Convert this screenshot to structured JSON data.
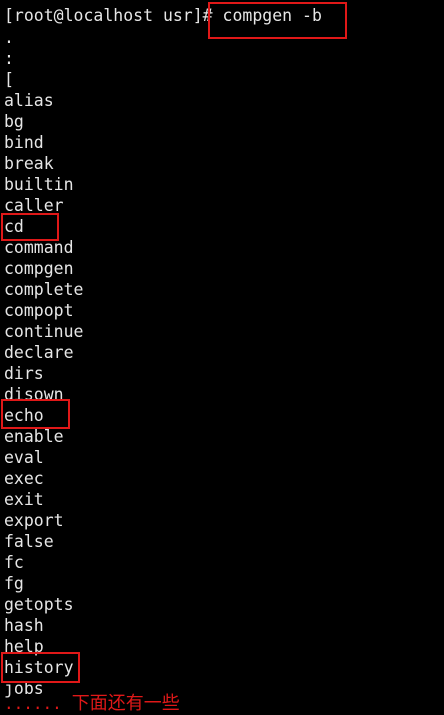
{
  "terminal": {
    "prompt": "[root@localhost usr]# ",
    "command": "compgen -b",
    "builtins": [
      ".",
      ":",
      "[",
      "alias",
      "bg",
      "bind",
      "break",
      "builtin",
      "caller",
      "cd",
      "command",
      "compgen",
      "complete",
      "compopt",
      "continue",
      "declare",
      "dirs",
      "disown",
      "echo",
      "enable",
      "eval",
      "exec",
      "exit",
      "export",
      "false",
      "fc",
      "fg",
      "getopts",
      "hash",
      "help",
      "history",
      "jobs"
    ]
  },
  "annotation": {
    "dots": "......",
    "note": "下面还有一些"
  },
  "colors": {
    "background": "#000000",
    "text": "#e6e6e6",
    "highlight": "#e01818"
  }
}
